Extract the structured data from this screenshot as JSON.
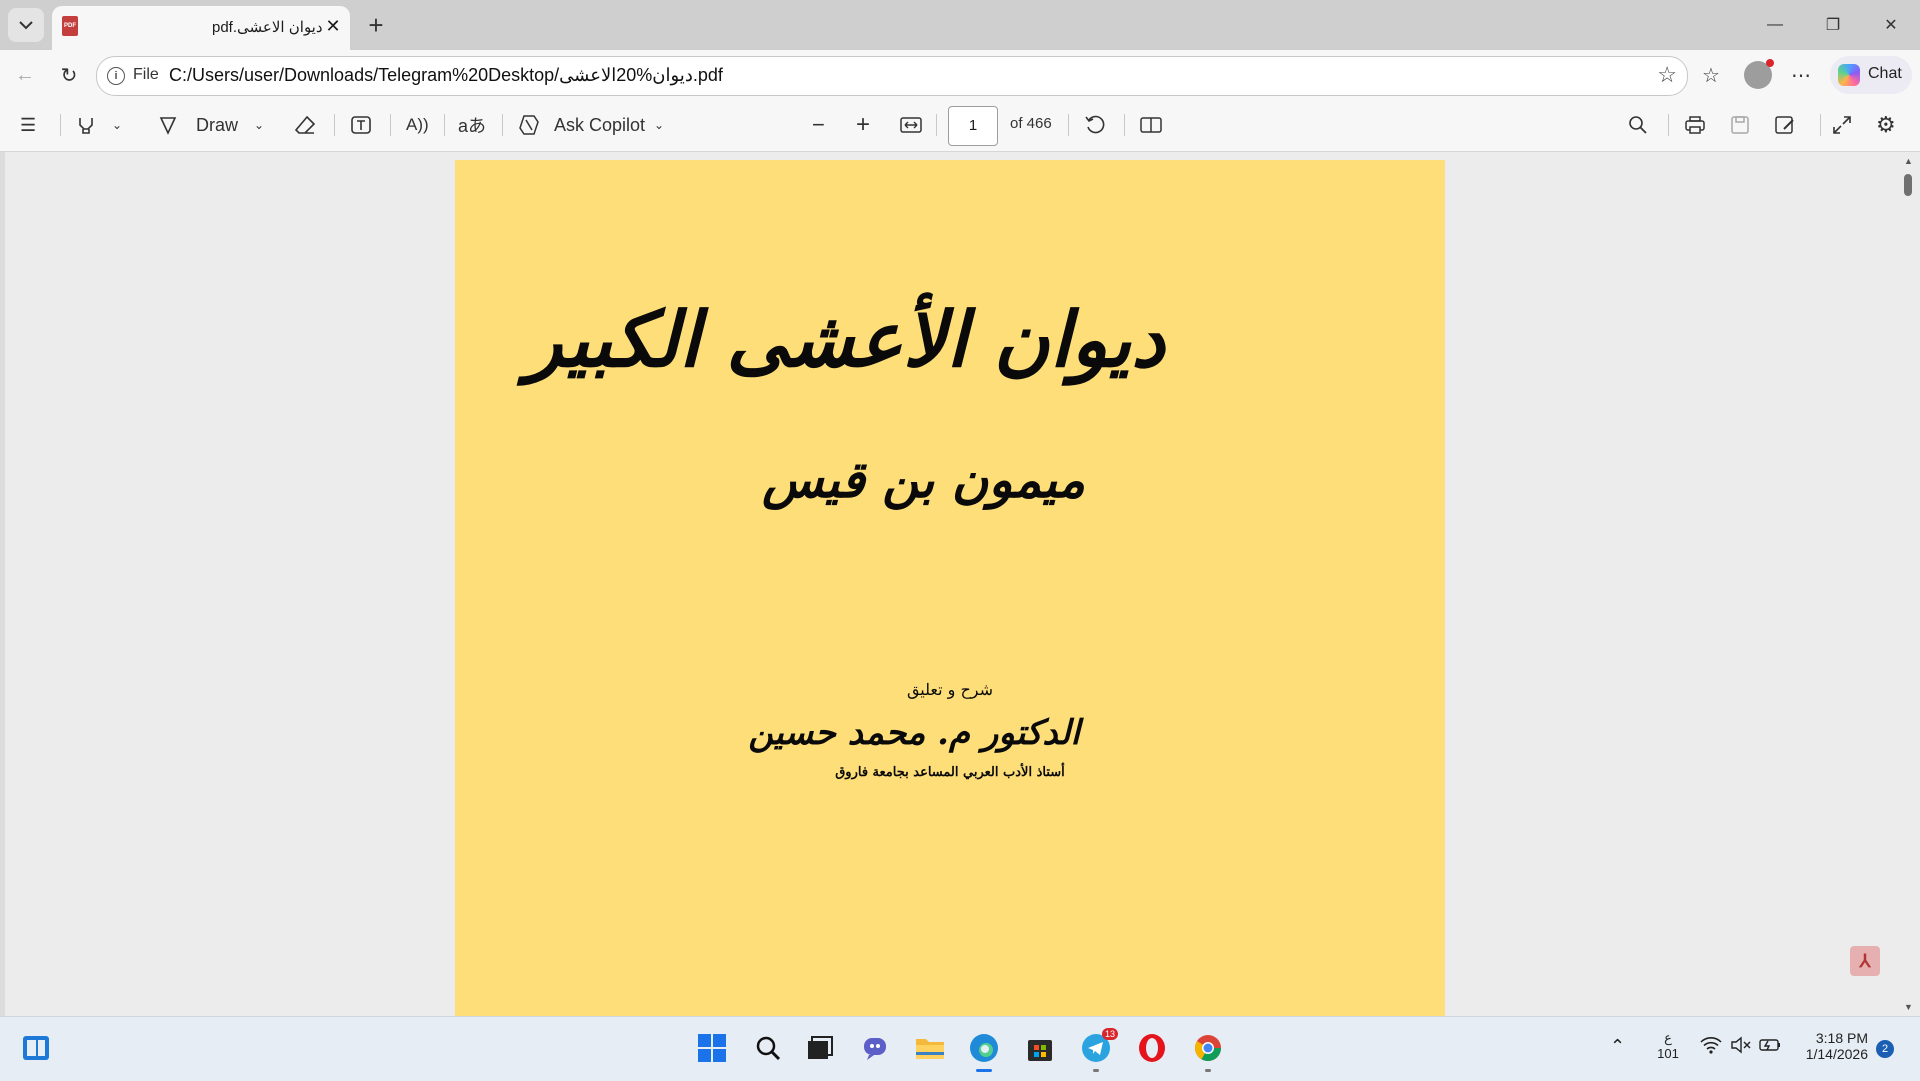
{
  "tab": {
    "title": "pdf.ديوان الاعشى",
    "close": "✕"
  },
  "window": {
    "minimize": "—",
    "maximize": "❐",
    "close": "✕"
  },
  "address": {
    "scheme_label": "File",
    "url": "C:/Users/user/Downloads/Telegram%20Desktop/ديوان%20الاعشى.pdf",
    "chat_label": "Chat"
  },
  "pdf_toolbar": {
    "draw_label": "Draw",
    "ask_copilot_label": "Ask Copilot",
    "page_number": "1",
    "page_total": "of 466"
  },
  "document": {
    "title": "ديوان الأعشى الكبير",
    "subtitle": "ميمون بن قيس",
    "commentary_label": "شرح و تعليق",
    "author": "الدكتور م. محمد حسين",
    "author_title": "أستاذ الأدب العربي المساعد بجامعة فاروق"
  },
  "taskbar": {
    "telegram_badge": "13",
    "lang_top": "ع",
    "lang_bottom": "101",
    "time": "3:18 PM",
    "date": "1/14/2026",
    "notification_count": "2"
  },
  "colors": {
    "page_background": "#fede78",
    "accent_red": "#d9262c"
  },
  "icons": [
    "tab-list-chevron-icon",
    "pdf-file-icon",
    "close-icon",
    "plus-icon",
    "back-arrow-icon",
    "refresh-icon",
    "info-icon",
    "star-icon",
    "favorites-icon",
    "profile-icon",
    "more-icon",
    "copilot-icon",
    "contents-icon",
    "highlight-icon",
    "draw-icon",
    "eraser-icon",
    "text-box-icon",
    "read-aloud-icon",
    "translate-icon",
    "copilot-icon",
    "zoom-out-icon",
    "zoom-in-icon",
    "fit-page-icon",
    "rotate-icon",
    "page-view-icon",
    "search-icon",
    "print-icon",
    "save-icon",
    "save-as-icon",
    "fullscreen-icon",
    "settings-icon",
    "acrobat-icon",
    "windows-start-icon",
    "search-icon",
    "task-view-icon",
    "teams-icon",
    "file-explorer-icon",
    "edge-icon",
    "store-icon",
    "telegram-icon",
    "opera-icon",
    "chrome-icon",
    "wifi-icon",
    "mute-icon",
    "battery-icon"
  ]
}
